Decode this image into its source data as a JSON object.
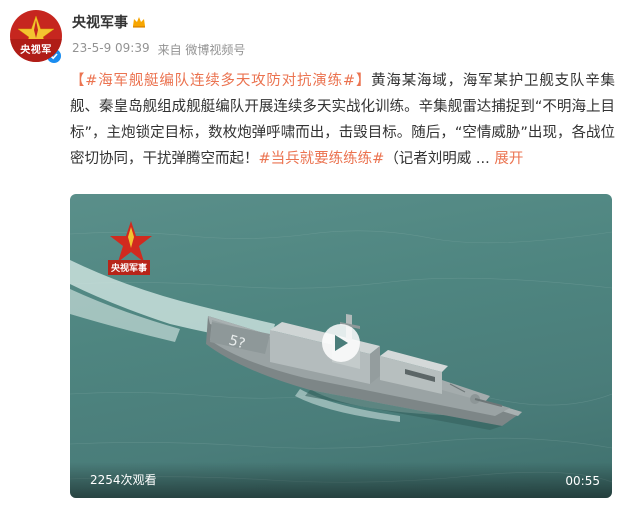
{
  "author": {
    "name": "央视军事",
    "avatar_label": "央视军"
  },
  "meta": {
    "time": "23-5-9 09:39",
    "source": "来自 微博视频号"
  },
  "post": {
    "topic1": "【#海军舰艇编队连续多天攻防对抗演练#】",
    "text1": "黄海某海域，海军某护卫舰支队辛集舰、秦皇岛舰组成舰艇编队开展连续多天实战化训练。辛集舰雷达捕捉到“不明海上目标”，主炮锁定目标，数枚炮弹呼啸而出，击毁目标。随后，“空情威胁”出现，各战位密切协同，干扰弹腾空而起！",
    "topic2": "#当兵就要练练练#",
    "text2": "（记者刘明威",
    "ellipsis": " ... ",
    "expand": "展开"
  },
  "video": {
    "watermark": "央视军事",
    "ship_number": "5?",
    "view_count": "2254次观看",
    "duration": "00:55"
  },
  "colors": {
    "link": "#eb7350",
    "brand_red": "#c6261f",
    "verified_blue": "#1a8cf0"
  },
  "icons": [
    "verified-icon",
    "crown-icon",
    "play-icon",
    "star-logo-icon"
  ]
}
